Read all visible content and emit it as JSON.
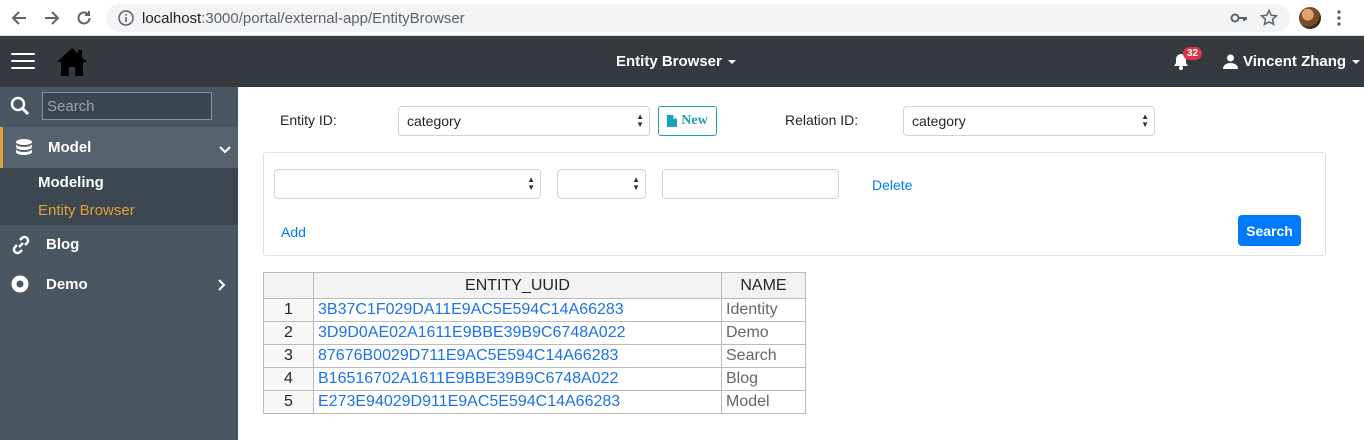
{
  "browser": {
    "url_host": "localhost",
    "url_rest": ":3000/portal/external-app/EntityBrowser"
  },
  "topnav": {
    "app_title": "Entity Browser",
    "notification_count": "32",
    "user_name": "Vincent Zhang"
  },
  "sidebar": {
    "search_placeholder": "Search",
    "model_label": "Model",
    "sub_items": [
      {
        "label": "Modeling",
        "color": "#ffffff"
      },
      {
        "label": "Entity Browser",
        "color": "#e0a33a"
      }
    ],
    "blog_label": "Blog",
    "demo_label": "Demo"
  },
  "form": {
    "entity_id_label": "Entity ID:",
    "entity_id_value": "category",
    "new_button": "New",
    "relation_id_label": "Relation ID:",
    "relation_id_value": "category",
    "delete_link": "Delete",
    "add_link": "Add",
    "search_button": "Search"
  },
  "table": {
    "headers": [
      "",
      "ENTITY_UUID",
      "NAME"
    ],
    "rows": [
      {
        "num": "1",
        "uuid": "3B37C1F029DA11E9AC5E594C14A66283",
        "name": "Identity"
      },
      {
        "num": "2",
        "uuid": "3D9D0AE02A1611E9BBE39B9C6748A022",
        "name": "Demo"
      },
      {
        "num": "3",
        "uuid": "87676B0029D711E9AC5E594C14A66283",
        "name": "Search"
      },
      {
        "num": "4",
        "uuid": "B16516702A1611E9BBE39B9C6748A022",
        "name": "Blog"
      },
      {
        "num": "5",
        "uuid": "E273E94029D911E9AC5E594C14A66283",
        "name": "Model"
      }
    ]
  },
  "colors": {
    "topnav_bg": "#343a40",
    "sidebar_bg": "#4a5662",
    "active_accent": "#e0a33a",
    "link_blue": "#007bff"
  }
}
